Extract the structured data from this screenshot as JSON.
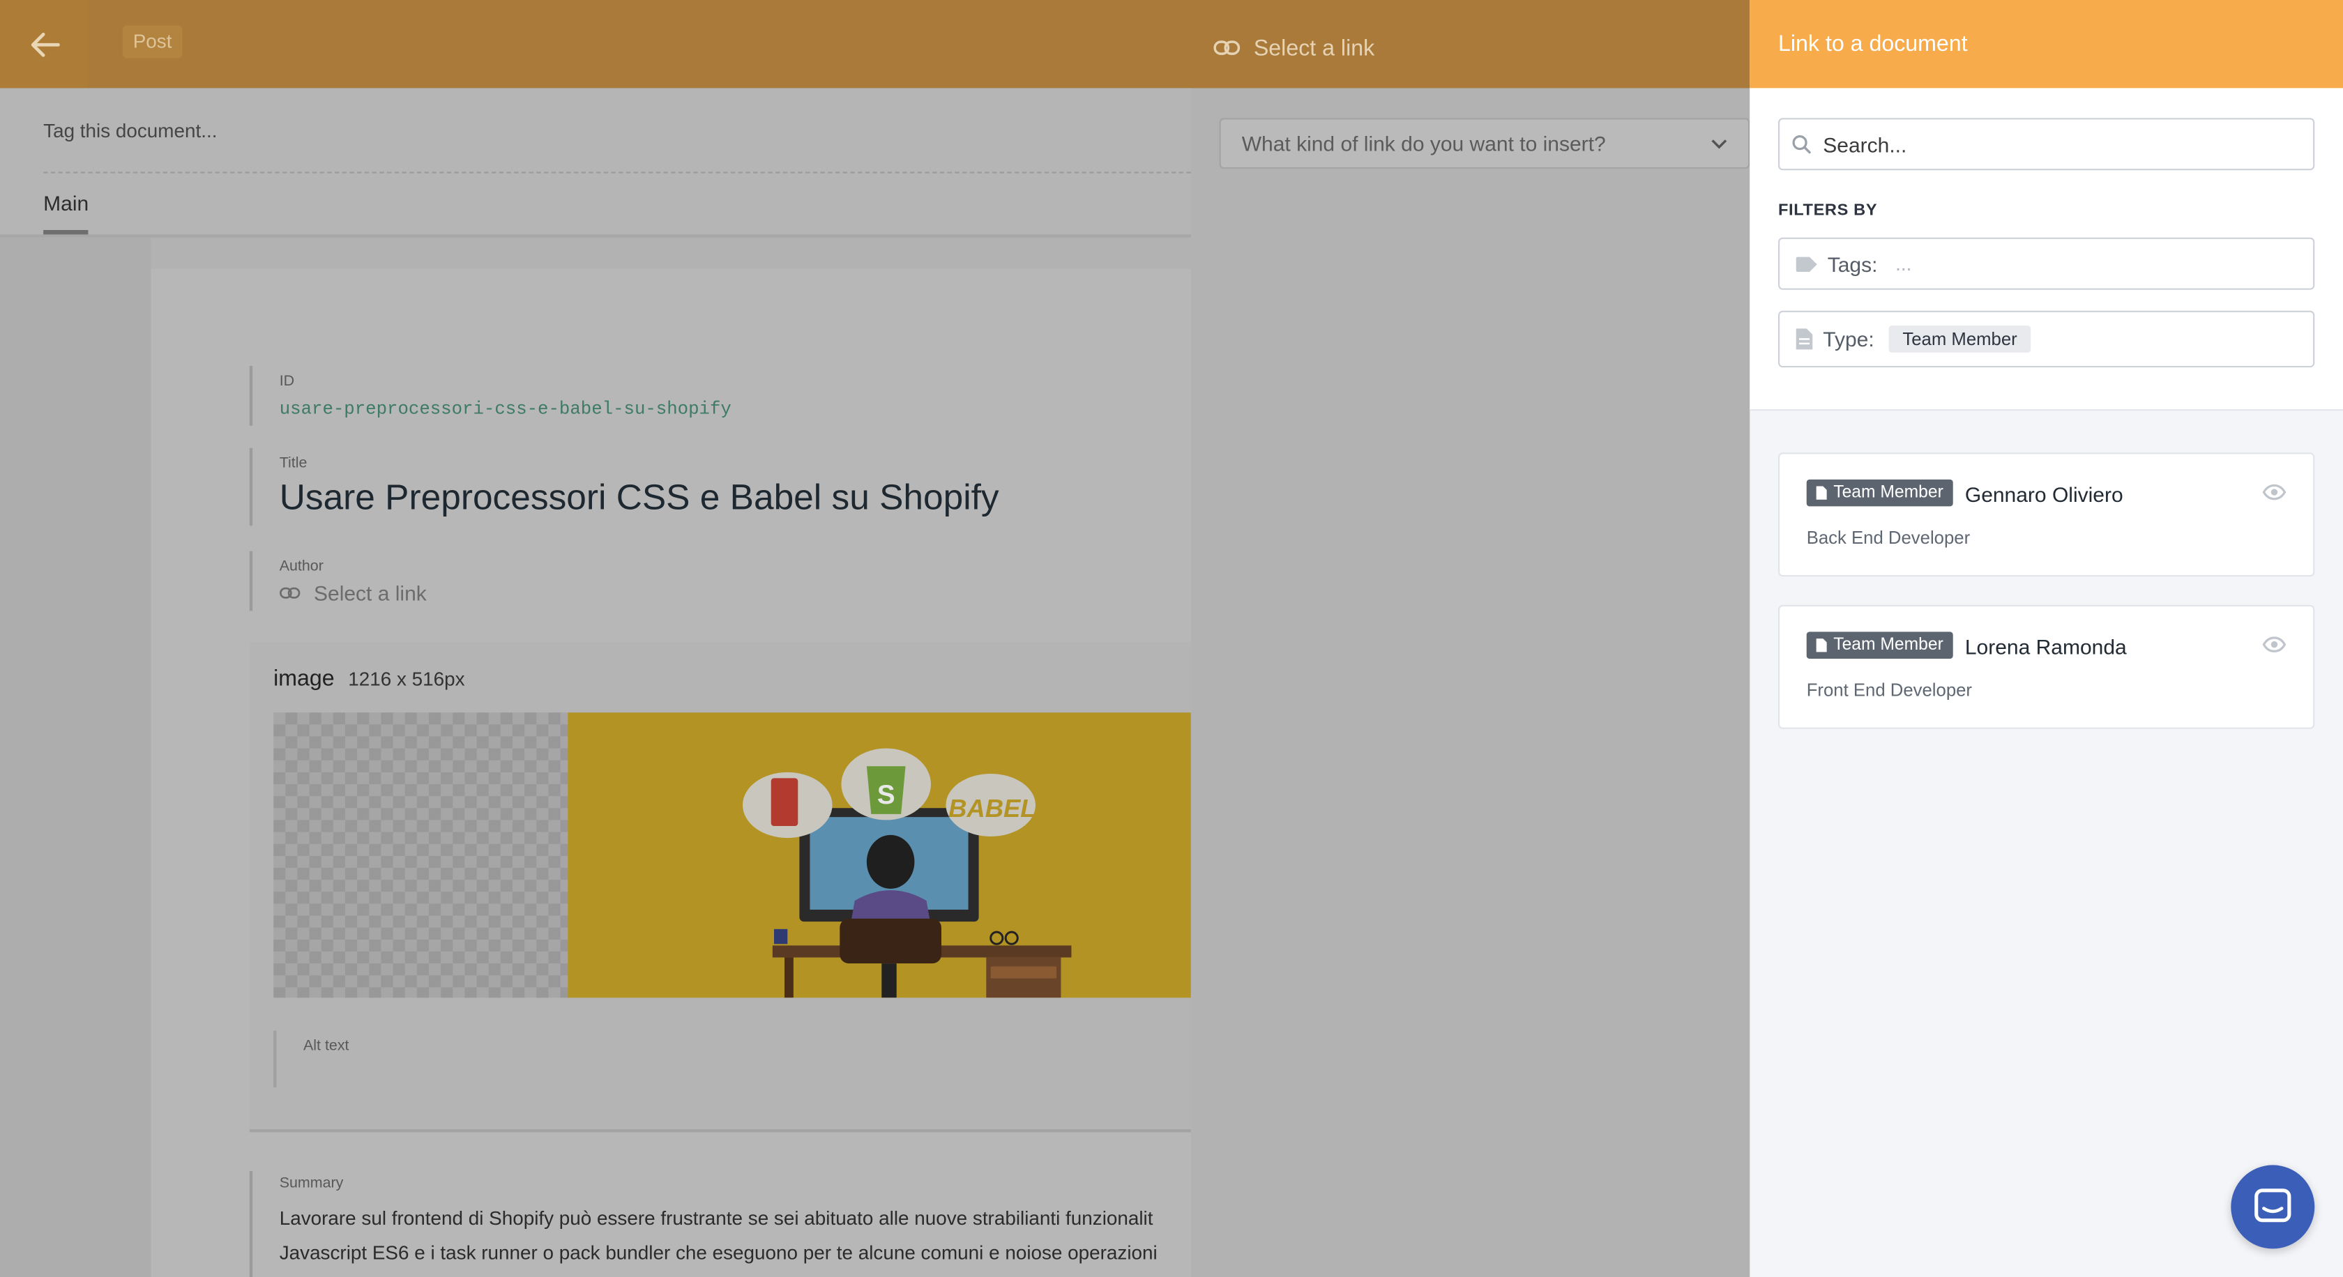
{
  "editor": {
    "doc_type": "Post",
    "top_link_label": "Select a link",
    "tag_placeholder": "Tag this document...",
    "tabs": [
      {
        "label": "Main"
      }
    ],
    "link_type_placeholder": "What kind of link do you want to insert?",
    "fields": {
      "id_label": "ID",
      "id_value": "usare-preprocessori-css-e-babel-su-shopify",
      "title_label": "Title",
      "title_value": "Usare Preprocessori CSS e Babel su Shopify",
      "author_label": "Author",
      "author_value": "Select a link",
      "image_name": "image",
      "image_dims": "1216 x 516px",
      "image_text": "BABEL",
      "alt_label": "Alt text",
      "summary_label": "Summary",
      "summary_line1": "Lavorare sul frontend di Shopify può essere frustrante se sei abituato alle nuove strabilianti funzionalit",
      "summary_line2": "Javascript ES6 e i task runner o pack bundler che eseguono per te alcune comuni e noiose operazioni"
    }
  },
  "panel": {
    "title": "Link to a document",
    "search_placeholder": "Search...",
    "filters_label": "FILTERS BY",
    "tags_label": "Tags:",
    "tags_value": "...",
    "type_label": "Type:",
    "type_value": "Team Member",
    "results": [
      {
        "badge": "Team Member",
        "name": "Gennaro Oliviero",
        "role": "Back End Developer"
      },
      {
        "badge": "Team Member",
        "name": "Lorena Ramonda",
        "role": "Front End Developer"
      }
    ]
  },
  "colors": {
    "panel_header": "#f7ab4a",
    "badge_bg": "#5c6470",
    "chat_button": "#3b5fb8"
  },
  "icons": [
    "back-arrow-icon",
    "link-icon",
    "chevron-down-icon",
    "search-icon",
    "tag-icon",
    "document-icon",
    "eye-icon",
    "chat-icon"
  ]
}
